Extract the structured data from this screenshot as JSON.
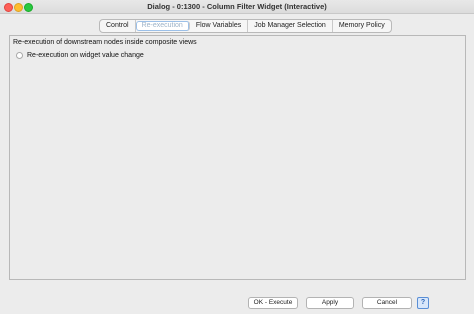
{
  "window": {
    "title": "Dialog - 0:1300 - Column Filter Widget (Interactive)"
  },
  "tabs": [
    {
      "label": "Control",
      "active": false
    },
    {
      "label": "Re-execution",
      "active": true
    },
    {
      "label": "Flow Variables",
      "active": false
    },
    {
      "label": "Job Manager Selection",
      "active": false
    },
    {
      "label": "Memory Policy",
      "active": false
    }
  ],
  "panel": {
    "heading": "Re-execution of downstream nodes inside composite views",
    "checkbox_label": "Re-execution on widget value change",
    "checkbox_checked": false
  },
  "footer": {
    "ok_label": "OK - Execute",
    "apply_label": "Apply",
    "cancel_label": "Cancel",
    "help_icon": "?"
  },
  "colors": {
    "close": "#fe5f57",
    "minimize": "#febc2e",
    "maximize": "#28c840",
    "accent": "#5a8fd6"
  }
}
